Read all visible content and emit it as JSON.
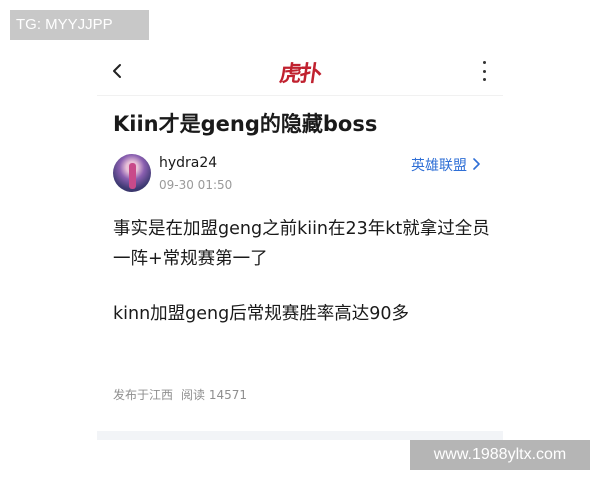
{
  "watermark_top": "TG: MYYJJPP",
  "watermark_bottom": "www.1988yltx.com",
  "header": {
    "back_icon": "chevron-left-icon",
    "logo": "虎扑",
    "more_icon": "more-vertical-icon"
  },
  "post": {
    "title": "Kiin才是geng的隐藏boss",
    "author": "hydra24",
    "date": "09-30 01:50",
    "forum": "英雄联盟",
    "paragraphs": [
      "事实是在加盟geng之前kiin在23年kt就拿过全员一阵+常规赛第一了",
      "kinn加盟geng后常规赛胜率高达90多"
    ],
    "location": "发布于江西",
    "reads": "阅读 14571"
  },
  "colors": {
    "accent": "#2f6fd6",
    "logo": "#c0212f"
  }
}
